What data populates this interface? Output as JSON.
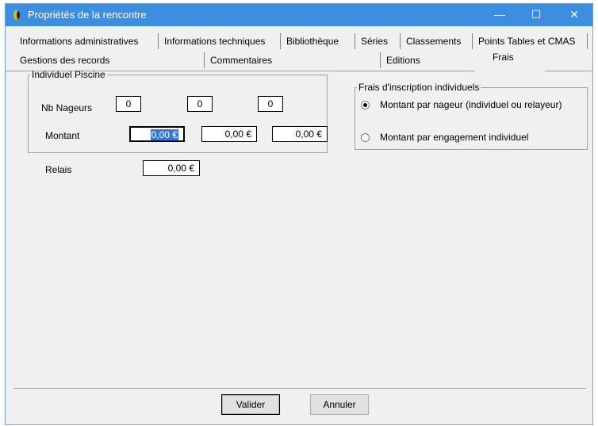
{
  "window": {
    "title": "Propriétés de la rencontre",
    "minimize": "—",
    "maximize": "☐",
    "close": "✕"
  },
  "tabs_row1": [
    "Informations administratives",
    "Informations techniques",
    "Bibliothèque",
    "Séries",
    "Classements",
    "Points Tables et CMAS"
  ],
  "tabs_row2": [
    "Gestions des records",
    "Commentaires",
    "Editions",
    "Frais"
  ],
  "active_tab": "Frais",
  "individuel_piscine": {
    "legend": "Individuel Piscine",
    "nb_nageurs_label": "Nb Nageurs",
    "nb_nageurs_values": [
      "0",
      "0",
      "0"
    ],
    "montant_label": "Montant",
    "montant_values": [
      "0,00 €",
      "0,00 €",
      "0,00 €"
    ]
  },
  "relais": {
    "label": "Relais",
    "value": "0,00 €"
  },
  "frais_inscription": {
    "legend": "Frais d'inscription individuels",
    "options": [
      "Montant par nageur (individuel ou relayeur)",
      "Montant par engagement individuel"
    ],
    "selected_index": 0
  },
  "buttons": {
    "valider": "Valider",
    "annuler": "Annuler"
  },
  "colors": {
    "titlebar": "#3d8ee0",
    "selection": "#3478d6",
    "window_bg": "#f0f0f0"
  }
}
